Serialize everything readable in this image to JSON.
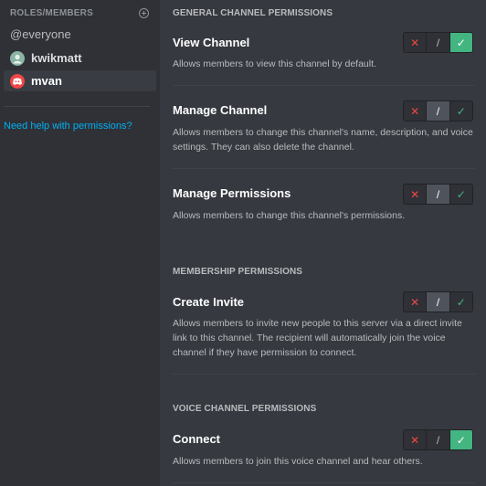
{
  "sidebar": {
    "header": "ROLES/MEMBERS",
    "items": [
      {
        "label": "@everyone"
      },
      {
        "label": "kwikmatt"
      },
      {
        "label": "mvan"
      }
    ],
    "help_link": "Need help with permissions?"
  },
  "sections": {
    "general": "GENERAL CHANNEL PERMISSIONS",
    "membership": "MEMBERSHIP PERMISSIONS",
    "voice": "VOICE CHANNEL PERMISSIONS"
  },
  "permissions": {
    "view_channel": {
      "name": "View Channel",
      "description": "Allows members to view this channel by default.",
      "state": "allow"
    },
    "manage_channel": {
      "name": "Manage Channel",
      "description_1": "Allows members to change this channel's name, description, and voice",
      "description_2": "settings. They can also delete the channel.",
      "state": "passthrough"
    },
    "manage_permissions": {
      "name": "Manage Permissions",
      "description": "Allows members to change this channel's permissions.",
      "state": "passthrough"
    },
    "create_invite": {
      "name": "Create Invite",
      "description_1": "Allows members to invite new people to this server via a direct invite",
      "description_2": "link to this channel. The recipient will automatically join the voice",
      "description_3": "channel if they have permission to connect.",
      "state": "passthrough"
    },
    "connect": {
      "name": "Connect",
      "description": "Allows members to join this voice channel and hear others.",
      "state": "allow"
    }
  },
  "toggle": {
    "deny": "✕",
    "passthrough": "/",
    "allow": "✓"
  },
  "colors": {
    "deny": "#f04747",
    "allow": "#43b581",
    "link": "#00b0f4",
    "background": "#36393f",
    "sidebar": "#2f3136"
  }
}
